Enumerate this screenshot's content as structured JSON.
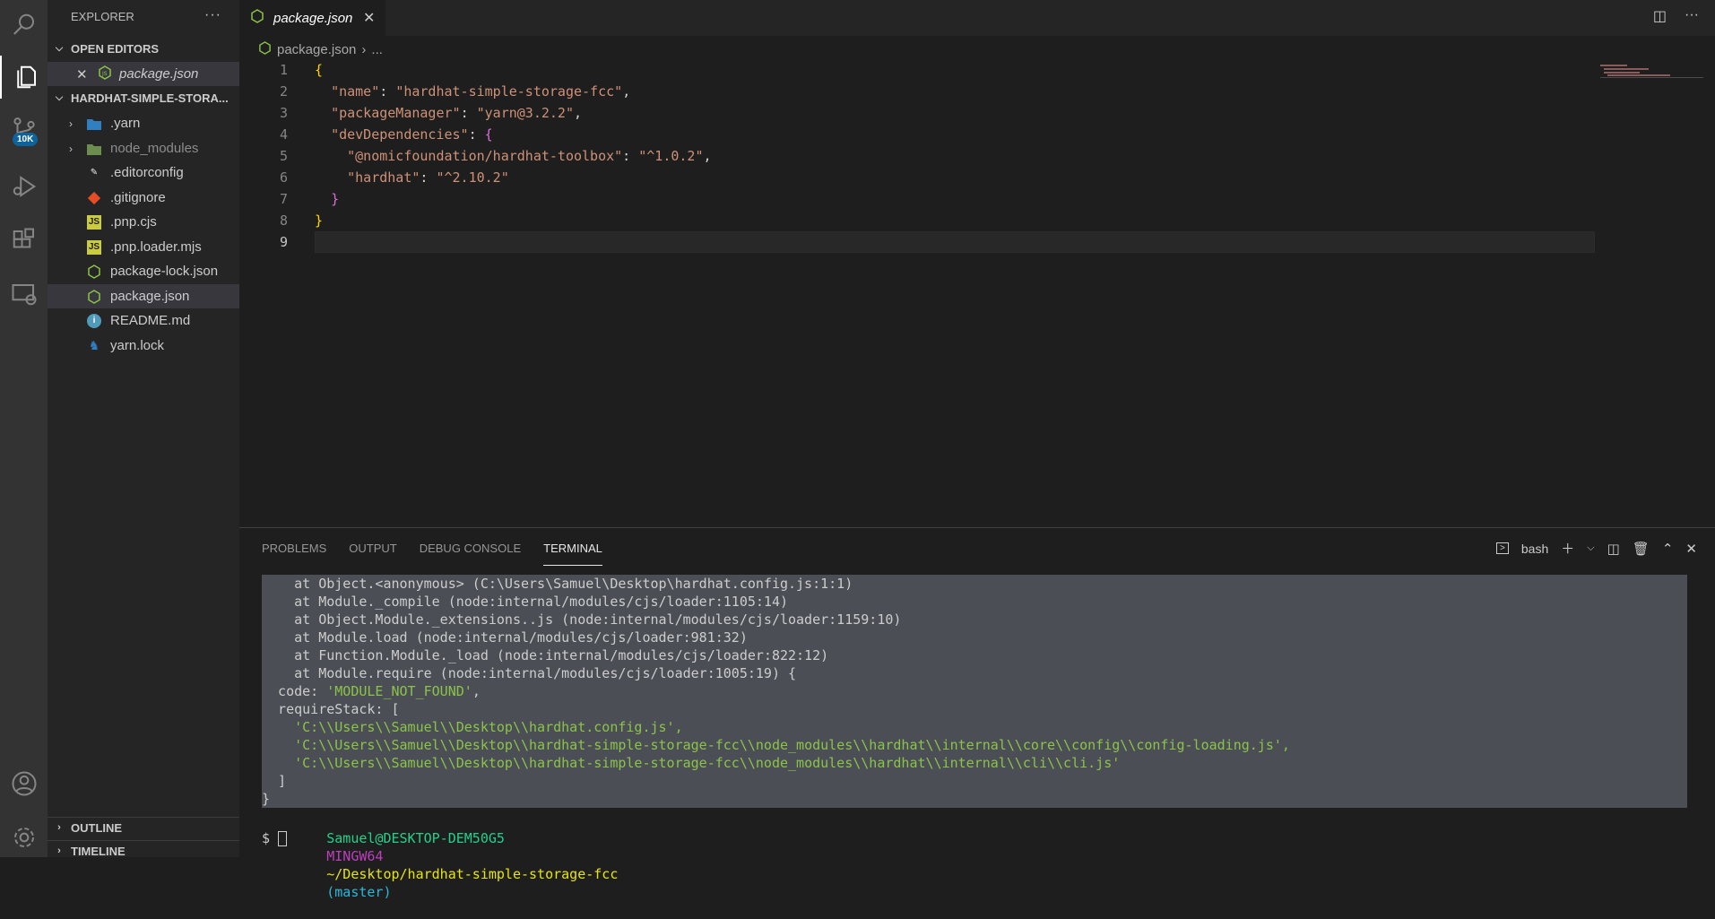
{
  "activity_bar": {
    "items": [
      "search-icon",
      "files-icon",
      "source-control-icon",
      "run-debug-icon",
      "extensions-icon",
      "remote-explorer-icon"
    ],
    "badge": "10K",
    "bottom": [
      "account-icon",
      "settings-gear-icon"
    ]
  },
  "sidebar": {
    "title": "EXPLORER",
    "more": "···",
    "open_editors": {
      "header": "OPEN EDITORS",
      "items": [
        {
          "label": "package.json"
        }
      ]
    },
    "folder": {
      "header": "HARDHAT-SIMPLE-STORA...",
      "items": [
        {
          "label": ".yarn",
          "type": "folder",
          "icon": "yarn-folder-icon"
        },
        {
          "label": "node_modules",
          "type": "folder",
          "icon": "node-folder-icon"
        },
        {
          "label": ".editorconfig",
          "type": "file",
          "icon": "editorconfig-icon"
        },
        {
          "label": ".gitignore",
          "type": "file",
          "icon": "git-icon"
        },
        {
          "label": ".pnp.cjs",
          "type": "file",
          "icon": "js-icon"
        },
        {
          "label": ".pnp.loader.mjs",
          "type": "file",
          "icon": "js-icon"
        },
        {
          "label": "package-lock.json",
          "type": "file",
          "icon": "node-icon"
        },
        {
          "label": "package.json",
          "type": "file",
          "icon": "node-icon"
        },
        {
          "label": "README.md",
          "type": "file",
          "icon": "info-icon"
        },
        {
          "label": "yarn.lock",
          "type": "file",
          "icon": "yarn-icon"
        }
      ]
    },
    "outline": "OUTLINE",
    "timeline": "TIMELINE"
  },
  "editor": {
    "tab_label": "package.json",
    "breadcrumb": {
      "file": "package.json",
      "rest": "..."
    },
    "lines": [
      {
        "n": "1"
      },
      {
        "n": "2"
      },
      {
        "n": "3"
      },
      {
        "n": "4"
      },
      {
        "n": "5"
      },
      {
        "n": "6"
      },
      {
        "n": "7"
      },
      {
        "n": "8"
      },
      {
        "n": "9"
      }
    ],
    "code": {
      "l1": "{",
      "l2_key": "\"name\"",
      "l2_val": "\"hardhat-simple-storage-fcc\"",
      "l3_key": "\"packageManager\"",
      "l3_val": "\"yarn@3.2.2\"",
      "l4_key": "\"devDependencies\"",
      "l4_brace": "{",
      "l5_key": "\"@nomicfoundation/hardhat-toolbox\"",
      "l5_val": "\"^1.0.2\"",
      "l6_key": "\"hardhat\"",
      "l6_val": "\"^2.10.2\"",
      "l7": "}",
      "l8": "}"
    }
  },
  "panel": {
    "tabs": [
      "PROBLEMS",
      "OUTPUT",
      "DEBUG CONSOLE",
      "TERMINAL"
    ],
    "active_tab": "TERMINAL",
    "shell": "bash",
    "terminal_lines": [
      "    at Object.<anonymous> (C:\\Users\\Samuel\\Desktop\\hardhat.config.js:1:1)",
      "    at Module._compile (node:internal/modules/cjs/loader:1105:14)",
      "    at Object.Module._extensions..js (node:internal/modules/cjs/loader:1159:10)",
      "    at Module.load (node:internal/modules/cjs/loader:981:32)",
      "    at Function.Module._load (node:internal/modules/cjs/loader:822:12)",
      "    at Module.require (node:internal/modules/cjs/loader:1005:19) {"
    ],
    "code_label": "  code: ",
    "code_val": "'MODULE_NOT_FOUND'",
    "require_label": "  requireStack: [",
    "require_items": [
      "'C:\\\\Users\\\\Samuel\\\\Desktop\\\\hardhat.config.js',",
      "'C:\\\\Users\\\\Samuel\\\\Desktop\\\\hardhat-simple-storage-fcc\\\\node_modules\\\\hardhat\\\\internal\\\\core\\\\config\\\\config-loading.js',",
      "'C:\\\\Users\\\\Samuel\\\\Desktop\\\\hardhat-simple-storage-fcc\\\\node_modules\\\\hardhat\\\\internal\\\\cli\\\\cli.js'"
    ],
    "close_bracket": "  ]",
    "close_brace": "}",
    "prompt_user": "Samuel@DESKTOP-DEM50G5",
    "prompt_env": "MINGW64",
    "prompt_path": "~/Desktop/hardhat-simple-storage-fcc",
    "prompt_branch": "(master)",
    "prompt_symbol": "$"
  }
}
